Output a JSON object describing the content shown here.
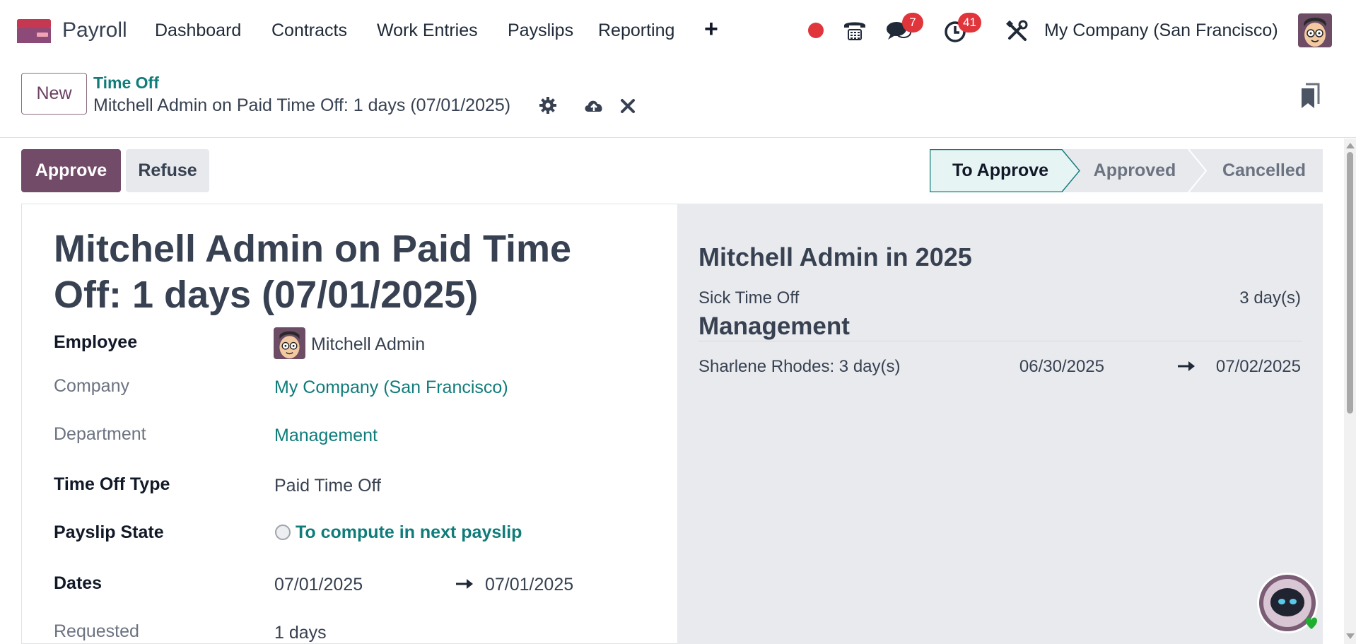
{
  "header": {
    "app_name": "Payroll",
    "nav": [
      "Dashboard",
      "Contracts",
      "Work Entries",
      "Payslips",
      "Reporting"
    ],
    "add_label": "+",
    "messages_count": "7",
    "activities_count": "41",
    "company": "My Company (San Francisco)"
  },
  "control_panel": {
    "new_label": "New",
    "breadcrumb": "Time Off",
    "record_title": "Mitchell Admin on Paid Time Off: 1 days (07/01/2025)"
  },
  "status_bar": {
    "approve_label": "Approve",
    "refuse_label": "Refuse",
    "stages": [
      "To Approve",
      "Approved",
      "Cancelled"
    ],
    "active_stage": "To Approve"
  },
  "form": {
    "title": "Mitchell Admin on Paid Time Off: 1 days (07/01/2025)",
    "employee_label": "Employee",
    "employee_value": "Mitchell Admin",
    "company_label": "Company",
    "company_value": "My Company (San Francisco)",
    "department_label": "Department",
    "department_value": "Management",
    "type_label": "Time Off Type",
    "type_value": "Paid Time Off",
    "payslip_label": "Payslip State",
    "payslip_value": "To compute in next payslip",
    "dates_label": "Dates",
    "date_from": "07/01/2025",
    "date_to": "07/01/2025",
    "requested_label": "Requested",
    "requested_value": "1 days"
  },
  "side_panel": {
    "title": "Mitchell Admin in 2025",
    "sick_label": "Sick Time Off",
    "sick_value": "3 day(s)",
    "section": "Management",
    "row_label": "Sharlene Rhodes: 3 day(s)",
    "row_from": "06/30/2025",
    "row_to": "07/02/2025"
  },
  "colors": {
    "brand": "#714b67",
    "link": "#0f7c7a",
    "badge": "#e0353b"
  }
}
